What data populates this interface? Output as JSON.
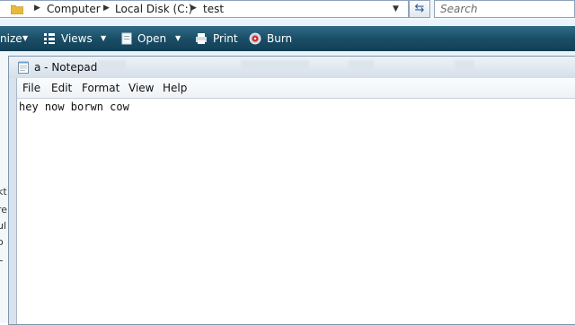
{
  "explorer": {
    "breadcrumbs": [
      "Computer",
      "Local Disk (C:)",
      "test"
    ],
    "search_placeholder": "Search",
    "toolbar": {
      "organize_label": "nize",
      "views_label": "Views",
      "open_label": "Open",
      "print_label": "Print",
      "burn_label": "Burn"
    },
    "left_cutoff": [
      "kt",
      "re",
      "ul",
      "o",
      "L"
    ]
  },
  "notepad": {
    "title": "a - Notepad",
    "menu": [
      "File",
      "Edit",
      "Format",
      "View",
      "Help"
    ],
    "content": "hey now borwn cow"
  },
  "colors": {
    "toolbar": "#1b4e67",
    "title_bar": "#e3ebf2",
    "text": "#111111"
  },
  "icons": [
    "folder-icon",
    "chevron-right-icon",
    "dropdown-arrow-icon",
    "refresh-icon",
    "views-icon",
    "open-icon",
    "print-icon",
    "burn-icon",
    "notepad-doc-icon"
  ]
}
